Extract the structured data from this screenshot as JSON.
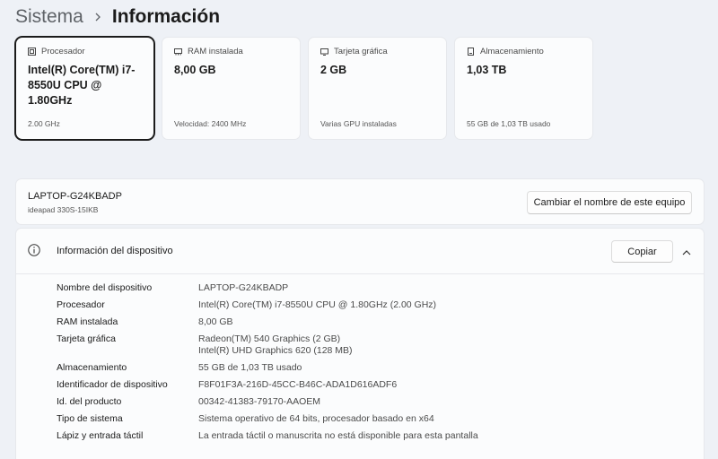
{
  "breadcrumb": {
    "parent": "Sistema",
    "current": "Información"
  },
  "cards": [
    {
      "label": "Procesador",
      "value": "Intel(R) Core(TM) i7-8550U CPU @ 1.80GHz",
      "sub": "2.00 GHz",
      "icon": "processor-icon"
    },
    {
      "label": "RAM instalada",
      "value": "8,00 GB",
      "sub": "Velocidad: 2400 MHz",
      "icon": "ram-icon"
    },
    {
      "label": "Tarjeta gráfica",
      "value": "2 GB",
      "sub": "Varias GPU instaladas",
      "icon": "graphics-card-icon"
    },
    {
      "label": "Almacenamiento",
      "value": "1,03 TB",
      "sub": "55 GB de 1,03 TB usado",
      "icon": "storage-icon"
    }
  ],
  "pc": {
    "name": "LAPTOP-G24KBADP",
    "model": "ideapad 330S-15IKB",
    "rename_label": "Cambiar el nombre de este equipo"
  },
  "device": {
    "title": "Información del dispositivo",
    "copy_label": "Copiar",
    "specs": [
      {
        "key": "Nombre del dispositivo",
        "values": [
          "LAPTOP-G24KBADP"
        ]
      },
      {
        "key": "Procesador",
        "values": [
          "Intel(R) Core(TM) i7-8550U CPU @ 1.80GHz (2.00 GHz)"
        ]
      },
      {
        "key": "RAM instalada",
        "values": [
          "8,00 GB"
        ]
      },
      {
        "key": "Tarjeta gráfica",
        "values": [
          "Radeon(TM) 540 Graphics (2 GB)",
          "Intel(R) UHD Graphics 620 (128 MB)"
        ]
      },
      {
        "key": "Almacenamiento",
        "values": [
          "55 GB de 1,03 TB usado"
        ]
      },
      {
        "key": "Identificador de dispositivo",
        "values": [
          "F8F01F3A-216D-45CC-B46C-ADA1D616ADF6"
        ]
      },
      {
        "key": "Id. del producto",
        "values": [
          "00342-41383-79170-AAOEM"
        ]
      },
      {
        "key": "Tipo de sistema",
        "values": [
          "Sistema operativo de 64 bits, procesador basado en x64"
        ]
      },
      {
        "key": "Lápiz y entrada táctil",
        "values": [
          "La entrada táctil o manuscrita no está disponible para esta pantalla"
        ]
      }
    ]
  }
}
